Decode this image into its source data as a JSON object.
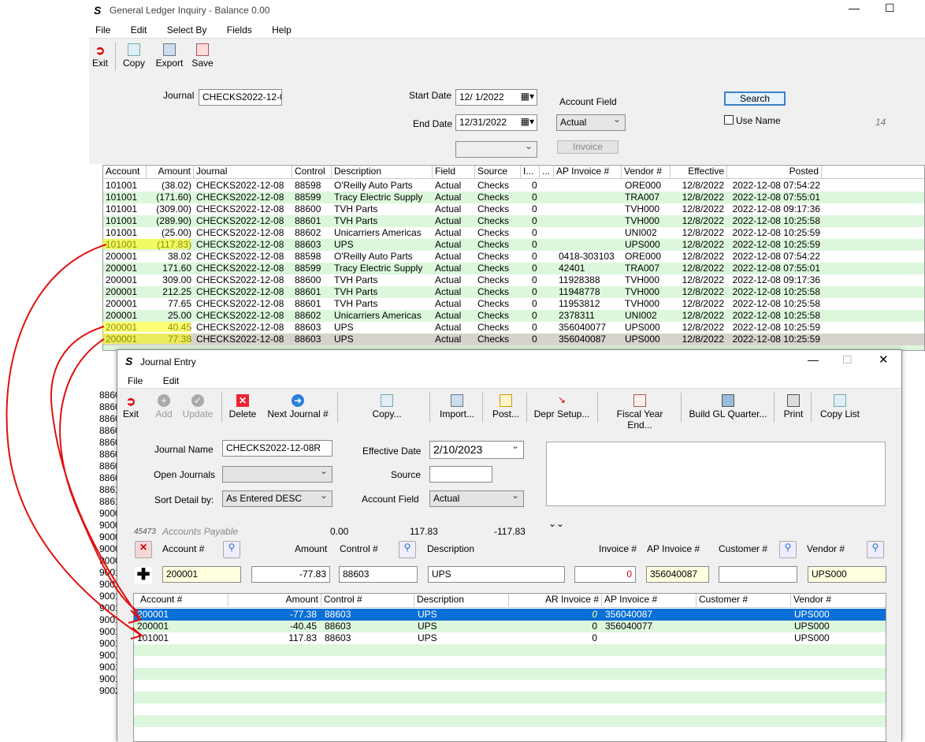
{
  "gl": {
    "title": "General Ledger Inquiry - Balance 0.00",
    "menu": [
      "File",
      "Edit",
      "Select By",
      "Fields",
      "Help"
    ],
    "toolbar": {
      "exit": "Exit",
      "copy": "Copy",
      "export": "Export",
      "save": "Save"
    },
    "journal_label": "Journal",
    "journal_value": "CHECKS2022-12-0",
    "start_date_label": "Start Date",
    "start_date": "12/  1/2022",
    "end_date_label": "End Date",
    "end_date": "12/31/2022",
    "account_field_label": "Account Field",
    "account_field_value": "Actual",
    "invoice_btn": "Invoice",
    "search_btn": "Search",
    "use_name": "Use Name",
    "count": "14",
    "columns": [
      "Account",
      "Amount",
      "Journal",
      "Control",
      "Description",
      "Field",
      "Source",
      "I...",
      "...",
      "AP Invoice #",
      "Vendor #",
      "Effective",
      "Posted"
    ],
    "rows": [
      [
        "101001",
        "(38.02)",
        "CHECKS2022-12-08",
        "88598",
        "O'Reilly Auto Parts",
        "Actual",
        "Checks",
        "0",
        "",
        "ORE000",
        "12/8/2022",
        "2022-12-08 07:54:22"
      ],
      [
        "101001",
        "(171.60)",
        "CHECKS2022-12-08",
        "88599",
        "Tracy Electric Supply",
        "Actual",
        "Checks",
        "0",
        "",
        "TRA007",
        "12/8/2022",
        "2022-12-08 07:55:01"
      ],
      [
        "101001",
        "(309.00)",
        "CHECKS2022-12-08",
        "88600",
        "TVH Parts",
        "Actual",
        "Checks",
        "0",
        "",
        "TVH000",
        "12/8/2022",
        "2022-12-08 09:17:36"
      ],
      [
        "101001",
        "(289.90)",
        "CHECKS2022-12-08",
        "88601",
        "TVH Parts",
        "Actual",
        "Checks",
        "0",
        "",
        "TVH000",
        "12/8/2022",
        "2022-12-08 10:25:58"
      ],
      [
        "101001",
        "(25.00)",
        "CHECKS2022-12-08",
        "88602",
        "Unicarriers Americas",
        "Actual",
        "Checks",
        "0",
        "",
        "UNI002",
        "12/8/2022",
        "2022-12-08 10:25:59"
      ],
      [
        "101001",
        "(117.83)",
        "CHECKS2022-12-08",
        "88603",
        "UPS",
        "Actual",
        "Checks",
        "0",
        "",
        "UPS000",
        "12/8/2022",
        "2022-12-08 10:25:59"
      ],
      [
        "200001",
        "38.02",
        "CHECKS2022-12-08",
        "88598",
        "O'Reilly Auto Parts",
        "Actual",
        "Checks",
        "0",
        "0418-303103",
        "ORE000",
        "12/8/2022",
        "2022-12-08 07:54:22"
      ],
      [
        "200001",
        "171.60",
        "CHECKS2022-12-08",
        "88599",
        "Tracy Electric Supply",
        "Actual",
        "Checks",
        "0",
        "42401",
        "TRA007",
        "12/8/2022",
        "2022-12-08 07:55:01"
      ],
      [
        "200001",
        "309.00",
        "CHECKS2022-12-08",
        "88600",
        "TVH Parts",
        "Actual",
        "Checks",
        "0",
        "11928388",
        "TVH000",
        "12/8/2022",
        "2022-12-08 09:17:36"
      ],
      [
        "200001",
        "212.25",
        "CHECKS2022-12-08",
        "88601",
        "TVH Parts",
        "Actual",
        "Checks",
        "0",
        "11948778",
        "TVH000",
        "12/8/2022",
        "2022-12-08 10:25:58"
      ],
      [
        "200001",
        "77.65",
        "CHECKS2022-12-08",
        "88601",
        "TVH Parts",
        "Actual",
        "Checks",
        "0",
        "11953812",
        "TVH000",
        "12/8/2022",
        "2022-12-08 10:25:58"
      ],
      [
        "200001",
        "25.00",
        "CHECKS2022-12-08",
        "88602",
        "Unicarriers Americas",
        "Actual",
        "Checks",
        "0",
        "2378311",
        "UNI002",
        "12/8/2022",
        "2022-12-08 10:25:58"
      ],
      [
        "200001",
        "40.45",
        "CHECKS2022-12-08",
        "88603",
        "UPS",
        "Actual",
        "Checks",
        "0",
        "356040077",
        "UPS000",
        "12/8/2022",
        "2022-12-08 10:25:59"
      ],
      [
        "200001",
        "77.38",
        "CHECKS2022-12-08",
        "88603",
        "UPS",
        "Actual",
        "Checks",
        "0",
        "356040087",
        "UPS000",
        "12/8/2022",
        "2022-12-08 10:25:59"
      ]
    ],
    "bg_left_col": [
      "8860",
      "8860",
      "8860",
      "8860",
      "8860",
      "8860",
      "8860",
      "8860",
      "8861",
      "8861",
      "9000",
      "9000",
      "9000",
      "9000",
      "9000",
      "9001",
      "9001",
      "9001",
      "9001",
      "9001",
      "9001",
      "9001",
      "9001",
      "9001",
      "9001",
      "9002"
    ]
  },
  "je": {
    "title": "Journal Entry",
    "menu": [
      "File",
      "Edit"
    ],
    "toolbar": [
      "Exit",
      "Add",
      "Update",
      "Delete",
      "Next Journal #",
      "Copy...",
      "Import...",
      "Post...",
      "Depr Setup...",
      "Fiscal Year End...",
      "Build GL Quarter...",
      "Print",
      "Copy List"
    ],
    "journal_name_label": "Journal Name",
    "journal_name": "CHECKS2022-12-08R",
    "effective_date_label": "Effective Date",
    "effective_date": "2/10/2023",
    "open_journals_label": "Open Journals",
    "source_label": "Source",
    "sort_label": "Sort Detail by:",
    "sort_value": "As Entered DESC",
    "account_field_label": "Account Field",
    "account_field_value": "Actual",
    "summary_id": "45473",
    "summary_name": "Accounts Payable",
    "sum1": "0.00",
    "sum2": "117.83",
    "sum3": "-117.83",
    "entry_labels": {
      "account": "Account #",
      "amount": "Amount",
      "control": "Control #",
      "description": "Description",
      "invoice": "Invoice #",
      "ap_invoice": "AP Invoice #",
      "customer": "Customer #",
      "vendor": "Vendor #"
    },
    "entry": {
      "account": "200001",
      "amount": "-77.83",
      "control": "88603",
      "description": "UPS",
      "invoice": "0",
      "ap_invoice": "356040087",
      "customer": "",
      "vendor": "UPS000"
    },
    "columns": [
      "Account #",
      "Amount",
      "Control #",
      "Description",
      "AR Invoice #",
      "AP Invoice #",
      "Customer #",
      "Vendor #"
    ],
    "rows": [
      [
        "200001",
        "-77.38",
        "88603",
        "UPS",
        "0",
        "356040087",
        "",
        "UPS000"
      ],
      [
        "200001",
        "-40.45",
        "88603",
        "UPS",
        "0",
        "356040077",
        "",
        "UPS000"
      ],
      [
        "101001",
        "117.83",
        "88603",
        "UPS",
        "0",
        "",
        "",
        "UPS000"
      ]
    ]
  }
}
